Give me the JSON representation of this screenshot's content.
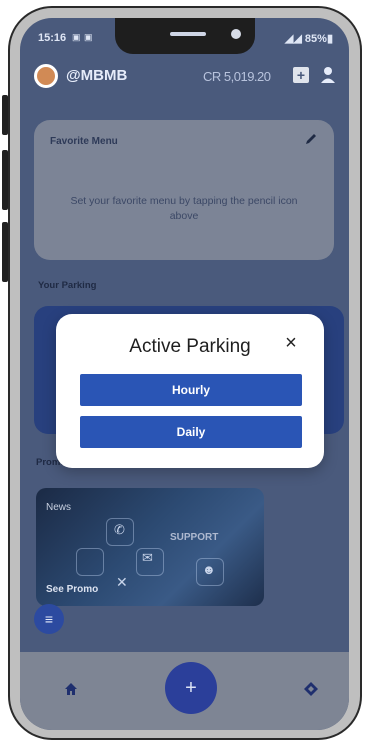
{
  "status": {
    "time": "15:16",
    "battery": "85%"
  },
  "header": {
    "username": "@MBMB",
    "credit": "CR 5,019.20",
    "add_label": "+"
  },
  "favorite": {
    "title": "Favorite Menu",
    "description": "Set your favorite menu by tapping the pencil icon above"
  },
  "parking": {
    "section_title": "Your Parking"
  },
  "promo": {
    "section_title": "Promo",
    "news_label": "News",
    "support_label": "SUPPORT",
    "see_promo_label": "See Promo"
  },
  "modal": {
    "title": "Active Parking",
    "close_label": "×",
    "options": [
      {
        "label": "Hourly"
      },
      {
        "label": "Daily"
      }
    ]
  },
  "nav": {
    "plus_label": "+"
  },
  "colors": {
    "accent": "#2a55b5",
    "header_bg": "#4a5a7c",
    "fab": "#2b3f9a"
  }
}
